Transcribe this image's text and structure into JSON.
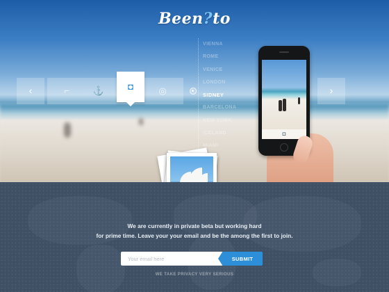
{
  "brand": {
    "logo_prefix": "Been",
    "logo_pin": "?",
    "logo_suffix": "to"
  },
  "cities": [
    {
      "name": "VIENNA",
      "active": false
    },
    {
      "name": "ROME",
      "active": false
    },
    {
      "name": "VENICE",
      "active": false
    },
    {
      "name": "LONDON",
      "active": false
    },
    {
      "name": "SIDNEY",
      "active": true
    },
    {
      "name": "BARCELONA",
      "active": false
    },
    {
      "name": "NEW YORK",
      "active": false
    },
    {
      "name": "ICELAND",
      "active": false
    },
    {
      "name": "MIAMI",
      "active": false
    }
  ],
  "slider": {
    "prev_icon": "chevron-left-icon",
    "next_icon": "chevron-right-icon",
    "items": [
      {
        "icon": "telescope-icon",
        "glyph": "⌐",
        "active": false
      },
      {
        "icon": "anchor-icon",
        "glyph": "⚓",
        "active": false
      },
      {
        "icon": "camera-icon",
        "glyph": "◘",
        "active": true
      },
      {
        "icon": "lifebuoy-icon",
        "glyph": "◎",
        "active": false
      }
    ]
  },
  "signup": {
    "tagline_line1": "We are currently in private beta but working hard",
    "tagline_line2": "for prime time. Leave your your email and be the among the first to join.",
    "email_placeholder": "Your email here",
    "submit_label": "SUBMIT",
    "privacy_note": "WE TAKE PRIVACY VERY SERIOUS"
  },
  "colors": {
    "accent": "#2e8fd9",
    "footer_bg": "#3f5065",
    "logo_pin": "#7cc4f2"
  }
}
